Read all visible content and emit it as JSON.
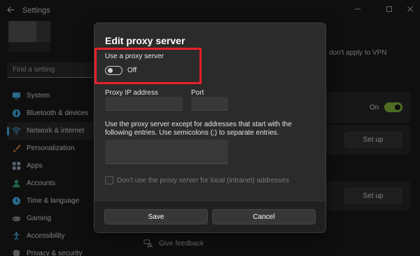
{
  "window": {
    "title": "Settings",
    "back_icon": "arrow-left-icon",
    "controls": [
      "minimize-icon",
      "maximize-icon",
      "close-icon"
    ]
  },
  "sidebar": {
    "search_placeholder": "Find a setting",
    "items": [
      {
        "label": "System",
        "icon": "monitor-icon",
        "color": "#4cc2ff"
      },
      {
        "label": "Bluetooth & devices",
        "icon": "bluetooth-icon",
        "color": "#4cc2ff"
      },
      {
        "label": "Network & internet",
        "icon": "wifi-icon",
        "color": "#4cc2ff",
        "active": true
      },
      {
        "label": "Personalization",
        "icon": "brush-icon",
        "color": "#f0a050"
      },
      {
        "label": "Apps",
        "icon": "apps-icon",
        "color": "#a0b8d8"
      },
      {
        "label": "Accounts",
        "icon": "person-icon",
        "color": "#3cb878"
      },
      {
        "label": "Time & language",
        "icon": "globe-clock-icon",
        "color": "#4cc2ff"
      },
      {
        "label": "Gaming",
        "icon": "gamepad-icon",
        "color": "#a0a0a0"
      },
      {
        "label": "Accessibility",
        "icon": "accessibility-icon",
        "color": "#4cc2ff"
      },
      {
        "label": "Privacy & security",
        "icon": "shield-icon",
        "color": "#a0a0a0"
      }
    ]
  },
  "background": {
    "vpn_note": "don't apply to VPN",
    "toggle_label": "On",
    "setup_label_1": "Set up",
    "setup_label_2": "Set up",
    "feedback": "Give feedback"
  },
  "dialog": {
    "title": "Edit proxy server",
    "use_proxy_label": "Use a proxy server",
    "toggle_state": "Off",
    "toggle_on": false,
    "ip_label": "Proxy IP address",
    "port_label": "Port",
    "ip_value": "",
    "port_value": "",
    "exceptions_text": "Use the proxy server except for addresses that start with the following entries. Use semicolons (;) to separate entries.",
    "exceptions_value": "",
    "local_checkbox_label": "Don't use the proxy server for local (intranet) addresses",
    "save_label": "Save",
    "cancel_label": "Cancel"
  },
  "colors": {
    "accent": "#4cc2ff",
    "highlight": "#e8202a",
    "toggle_on": "#8dc63f"
  }
}
